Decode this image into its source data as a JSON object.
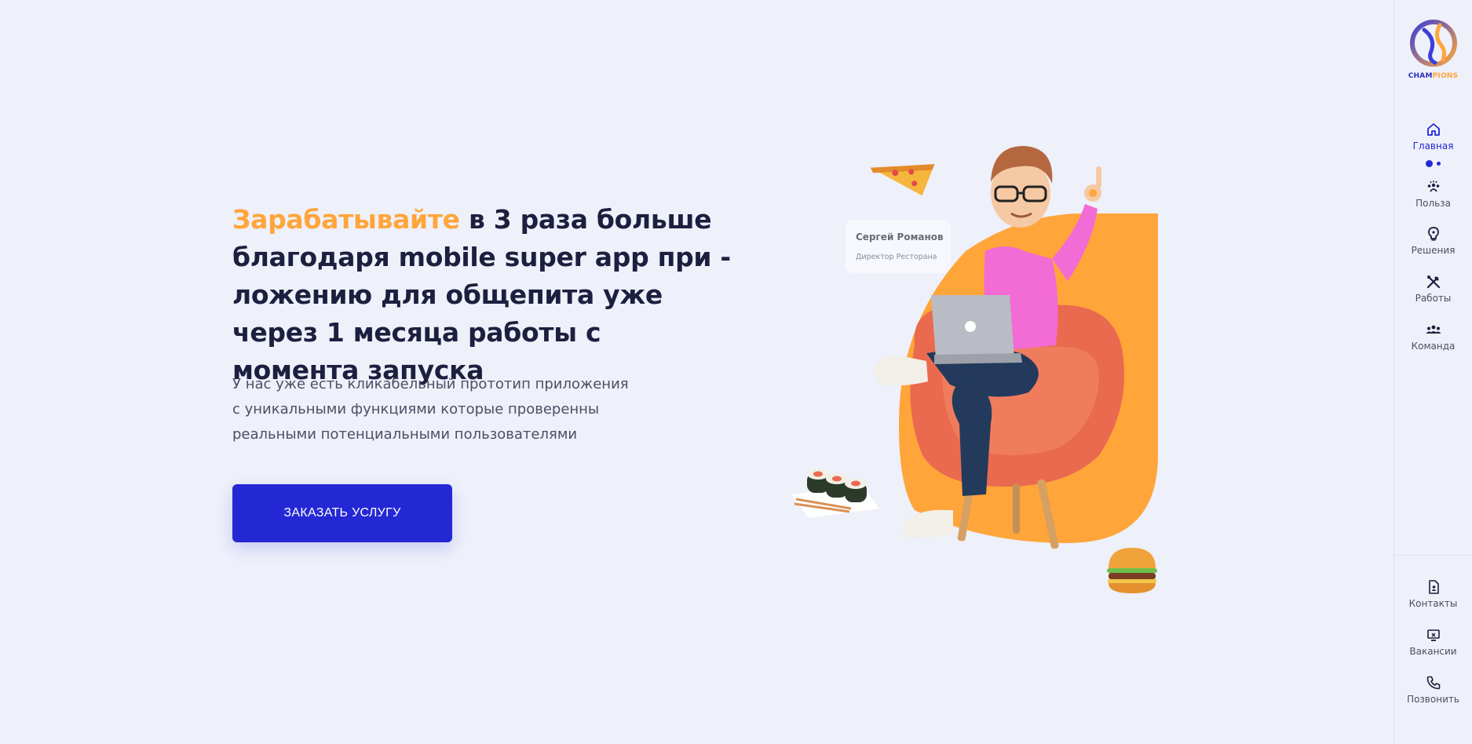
{
  "hero": {
    "title_accent": "Зарабатывайте",
    "title_rest": " в 3 раза больше благодаря mobile super app при - ложению для общепита уже через 1 месяца работы с момента запуска",
    "description": "У нас уже есть кликабельный прототип приложения с уникальными функциями которые проверенны реальными потенциальными пользователями",
    "cta_label": "ЗАКАЗАТЬ УСЛУГУ"
  },
  "person_card": {
    "name": "Сергей Романов",
    "role": "Директор Ресторана"
  },
  "logo": {
    "text_part1": "CHAM",
    "text_part2": "PIONS"
  },
  "sidebar": {
    "nav_items": [
      {
        "label": "Главная",
        "icon": "home-icon",
        "active": true
      },
      {
        "label": "Польза",
        "icon": "benefit-icon",
        "active": false
      },
      {
        "label": "Решения",
        "icon": "lightbulb-icon",
        "active": false
      },
      {
        "label": "Работы",
        "icon": "tools-icon",
        "active": false
      },
      {
        "label": "Команда",
        "icon": "team-icon",
        "active": false
      }
    ],
    "bottom_items": [
      {
        "label": "Контакты",
        "icon": "contact-card-icon"
      },
      {
        "label": "Вакансии",
        "icon": "vacancy-icon"
      },
      {
        "label": "Позвонить",
        "icon": "phone-icon"
      }
    ]
  },
  "colors": {
    "background": "#eef0fa",
    "accent_orange": "#ffa53a",
    "primary_blue": "#2428d4",
    "heading_dark": "#1d1f3f"
  }
}
